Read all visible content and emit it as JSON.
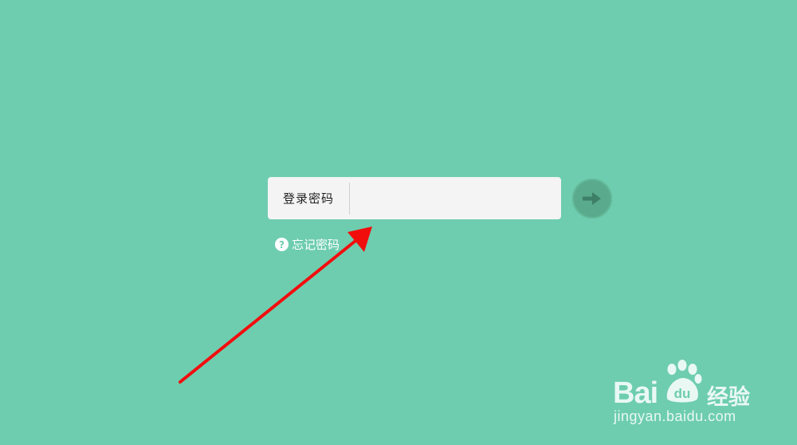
{
  "login": {
    "password_label": "登录密码",
    "password_value": "",
    "forgot_label": "忘记密码",
    "help_glyph": "?"
  },
  "submit": {
    "icon": "arrow-right-icon"
  },
  "watermark": {
    "brand": "Bai",
    "brand_du": "du",
    "sub": "经验",
    "url": "jingyan.baidu.com"
  },
  "colors": {
    "background": "#6ecdaf",
    "input_bg": "#f4f4f4",
    "button_bg": "#5aaa8d",
    "arrow_annotation": "#f20d0d"
  }
}
